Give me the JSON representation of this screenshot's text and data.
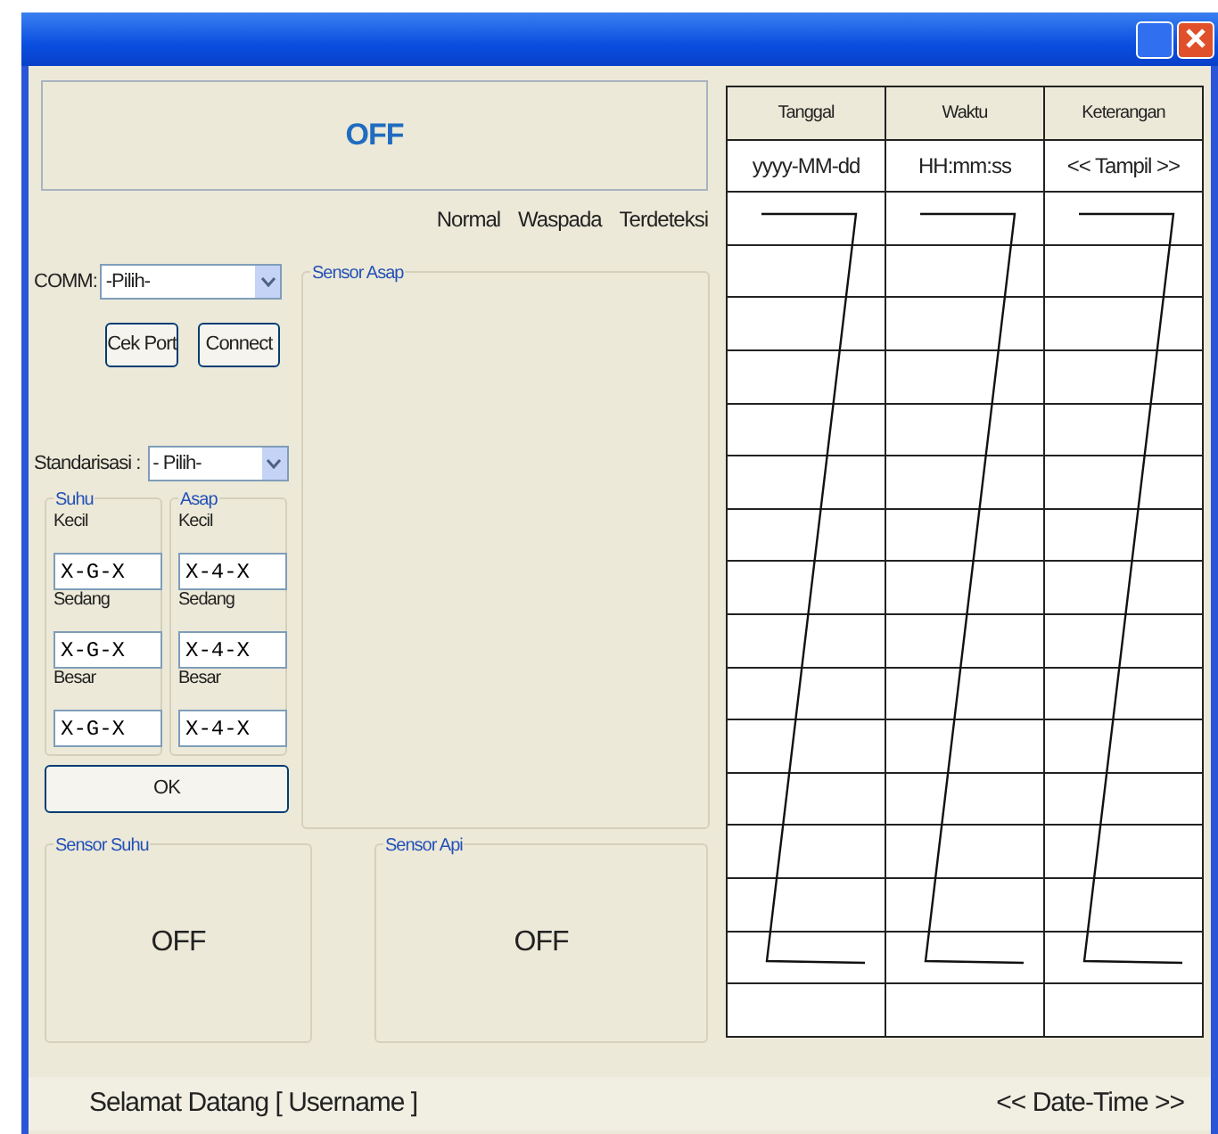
{
  "status_display": {
    "text": "OFF"
  },
  "legend": [
    "Normal",
    "Waspada",
    "Terdeteksi"
  ],
  "comm": {
    "label": "COMM:",
    "value": "-Pilih-"
  },
  "port_buttons": [
    "Cek Port",
    "Connect"
  ],
  "smoke_sensor": {
    "title": "Sensor Asap"
  },
  "standardization": {
    "label": "Standarisasi :",
    "value": "- Pilih-"
  },
  "thresholds": [
    {
      "title": "Suhu",
      "fields": [
        {
          "label": "Kecil",
          "value": "X-G-X"
        },
        {
          "label": "Sedang",
          "value": "X-G-X"
        },
        {
          "label": "Besar",
          "value": "X-G-X"
        }
      ]
    },
    {
      "title": "Asap",
      "fields": [
        {
          "label": "Kecil",
          "value": "X-4-X"
        },
        {
          "label": "Sedang",
          "value": "X-4-X"
        },
        {
          "label": "Besar",
          "value": "X-4-X"
        }
      ]
    }
  ],
  "ok_button": "OK",
  "temperature_sensor": {
    "title": "Sensor Suhu",
    "value": "OFF"
  },
  "fire_sensor": {
    "title": "Sensor Api",
    "value": "OFF"
  },
  "table": {
    "columns": [
      "Tanggal",
      "Waktu",
      "Keterangan"
    ],
    "rows": [
      [
        "yyyy-MM-dd",
        "HH:mm:ss",
        "<< Tampil >>"
      ]
    ]
  },
  "status_bar": {
    "left": "Selamat Datang [ Username ]",
    "right": "<< Date-Time >>"
  }
}
